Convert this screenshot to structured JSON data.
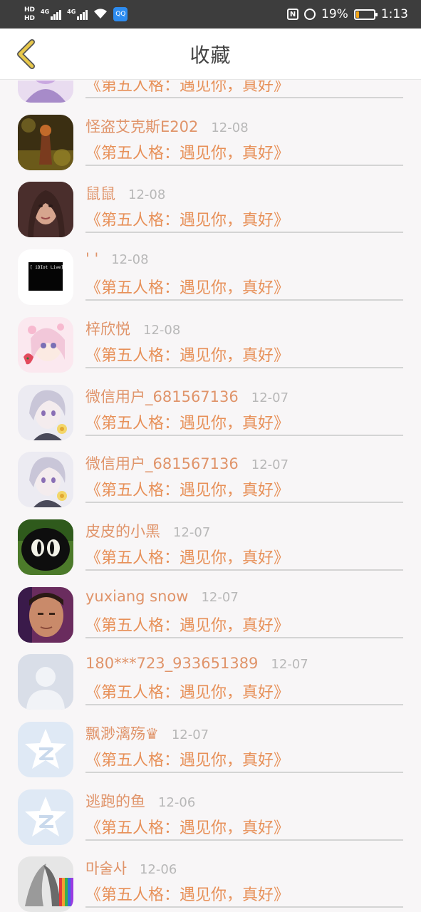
{
  "status_bar": {
    "hd_top": "HD",
    "hd_bottom": "HD",
    "net1": "4G",
    "net2": "4G",
    "app_badge": "QQ",
    "nfc": "N",
    "battery_percent": "19%",
    "battery_level": 0.19,
    "time": "1:13",
    "colors": {
      "bar": "#3d3d3d",
      "battery_fill": "#f2a516"
    }
  },
  "header": {
    "title": "收藏",
    "back_icon": "chevron-left-icon",
    "accent": "#e8c84a"
  },
  "items": [
    {
      "name": "",
      "date": "",
      "work": "《第五人格：遇见你，真好》",
      "avatar": "anime-girl-purple"
    },
    {
      "name": "怪盗艾克斯E202",
      "date": "12-08",
      "work": "《第五人格：遇见你，真好》",
      "avatar": "dark-fantasy"
    },
    {
      "name": "鼠鼠",
      "date": "12-08",
      "work": "《第五人格：遇见你，真好》",
      "avatar": "woman-portrait"
    },
    {
      "name": "' '",
      "date": "12-08",
      "work": "《第五人格：遇见你，真好》",
      "avatar": "black-square-text",
      "avatar_text": "[ iDIot Live]"
    },
    {
      "name": "梓欣悦",
      "date": "12-08",
      "work": "《第五人格：遇见你，真好》",
      "avatar": "anime-pink-girl"
    },
    {
      "name": "微信用户_681567136",
      "date": "12-07",
      "work": "《第五人格：遇见你，真好》",
      "avatar": "anime-silver-boy"
    },
    {
      "name": "微信用户_681567136",
      "date": "12-07",
      "work": "《第五人格：遇见你，真好》",
      "avatar": "anime-silver-boy"
    },
    {
      "name": "皮皮的小黑",
      "date": "12-07",
      "work": "《第五人格：遇见你，真好》",
      "avatar": "black-cat-eyes"
    },
    {
      "name": "yuxiang snow",
      "date": "12-07",
      "work": "《第五人格：遇见你，真好》",
      "avatar": "man-selfie"
    },
    {
      "name": "180***723_933651389",
      "date": "12-07",
      "work": "《第五人格：遇见你，真好》",
      "avatar": "default-person"
    },
    {
      "name": "飘渺漓殇♛",
      "date": "12-07",
      "work": "《第五人格：遇见你，真好》",
      "avatar": "qzone-star"
    },
    {
      "name": "逃跑的鱼",
      "date": "12-06",
      "work": "《第五人格：遇见你，真好》",
      "avatar": "qzone-star"
    },
    {
      "name": "마술사",
      "date": "12-06",
      "work": "《第五人格：遇见你，真好》",
      "avatar": "sketch-rainbow"
    }
  ],
  "colors": {
    "name": "#e0946a",
    "work": "#e79058",
    "date": "#b8b8b8",
    "background": "#f8f6f7"
  }
}
